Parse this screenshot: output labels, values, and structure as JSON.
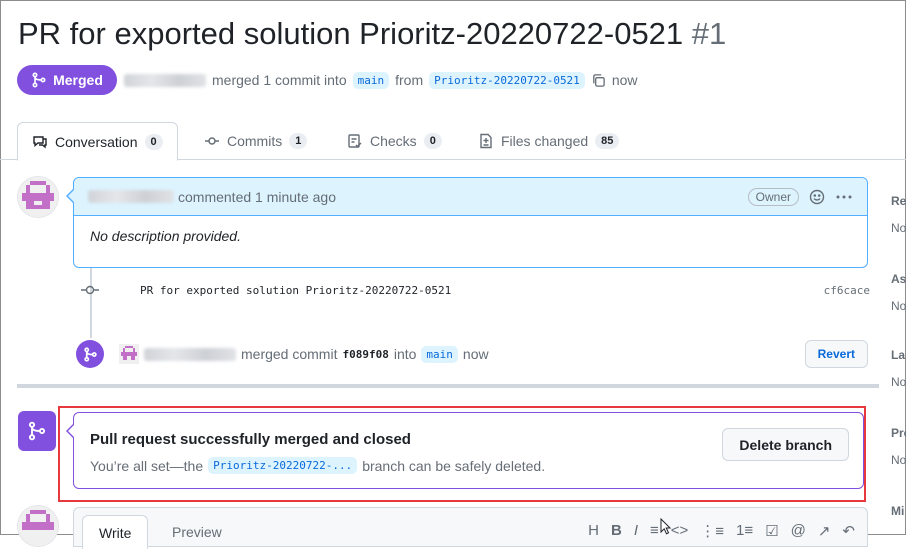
{
  "pr": {
    "title": "PR for exported solution Prioritz-20220722-0521",
    "number": "#1",
    "state": "Merged",
    "merged_text": "merged 1 commit into",
    "base_branch": "main",
    "from_text": "from",
    "head_branch": "Prioritz-20220722-0521",
    "time": "now"
  },
  "tabs": [
    {
      "label": "Conversation",
      "count": "0",
      "icon": "comment-icon"
    },
    {
      "label": "Commits",
      "count": "1",
      "icon": "commit-icon"
    },
    {
      "label": "Checks",
      "count": "0",
      "icon": "checklist-icon"
    },
    {
      "label": "Files changed",
      "count": "85",
      "icon": "file-diff-icon"
    }
  ],
  "comment": {
    "action": "commented 1 minute ago",
    "owner_badge": "Owner",
    "body": "No description provided."
  },
  "commit": {
    "message": "PR for exported solution Prioritz-20220722-0521",
    "sha": "cf6cace"
  },
  "merge_event": {
    "action": "merged commit",
    "sha": "f089f08",
    "into": "into",
    "branch": "main",
    "time": "now",
    "revert_label": "Revert"
  },
  "merged_box": {
    "title": "Pull request successfully merged and closed",
    "sub_prefix": "You’re all set—the",
    "branch": "Prioritz-20220722-...",
    "sub_suffix": "branch can be safely deleted.",
    "delete_label": "Delete branch"
  },
  "editor": {
    "write_label": "Write",
    "preview_label": "Preview",
    "toolbar": [
      "H",
      "B",
      "I",
      "≡",
      "<>",
      "⋮≡",
      "1≡",
      "☑",
      "@",
      "↗",
      "↶"
    ]
  },
  "sidebar": [
    {
      "heading": "Re",
      "value": "No"
    },
    {
      "heading": "As",
      "value": "No"
    },
    {
      "heading": "La",
      "value": "No"
    },
    {
      "heading": "Pro",
      "value": "No"
    },
    {
      "heading": "Mi",
      "value": ""
    }
  ],
  "colors": {
    "merged_purple": "#8250df",
    "link_blue": "#0969da",
    "highlight_red": "#e5393e"
  }
}
